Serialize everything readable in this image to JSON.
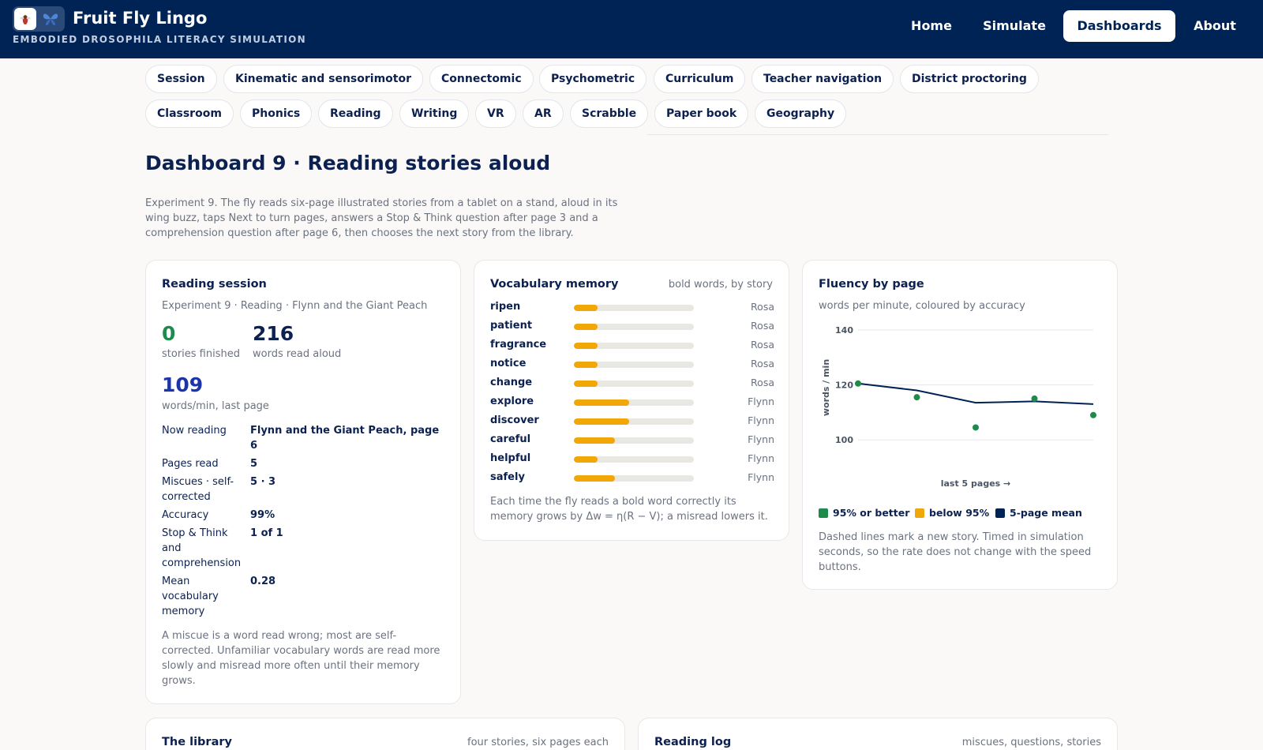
{
  "header": {
    "title": "Fruit Fly Lingo",
    "subtitle": "EMBODIED DROSOPHILA LITERACY SIMULATION",
    "nav": [
      "Home",
      "Simulate",
      "Dashboards",
      "About"
    ],
    "active_nav": "Dashboards"
  },
  "tabs": [
    [
      "Session",
      "Kinematic and sensorimotor",
      "Connectomic",
      "Psychometric",
      "Curriculum",
      "Teacher navigation",
      "District proctoring"
    ],
    [
      "Classroom",
      "Phonics",
      "Reading",
      "Writing",
      "VR",
      "AR",
      "Scrabble",
      "Paper book",
      "Geography"
    ]
  ],
  "page": {
    "title": "Dashboard 9 · Reading stories aloud",
    "intro": "Experiment 9. The fly reads six-page illustrated stories from a tablet on a stand, aloud in its wing buzz, taps Next to turn pages, answers a Stop & Think question after page 3 and a comprehension question after page 6, then chooses the next story from the library."
  },
  "session": {
    "title": "Reading session",
    "context": "Experiment 9 · Reading · Flynn and the Giant Peach",
    "stories_finished": "0",
    "stories_finished_label": "stories finished",
    "words_read": "216",
    "words_read_label": "words read aloud",
    "wpm": "109",
    "wpm_label": "words/min, last page",
    "details": [
      {
        "k": "Now reading",
        "v": "Flynn and the Giant Peach, page 6"
      },
      {
        "k": "Pages read",
        "v": "5"
      },
      {
        "k": "Miscues · self-corrected",
        "v": "5 · 3"
      },
      {
        "k": "Accuracy",
        "v": "99%"
      },
      {
        "k": "Stop & Think and comprehension",
        "v": "1 of 1"
      },
      {
        "k": "Mean vocabulary memory",
        "v": "0.28"
      }
    ],
    "note": "A miscue is a word read wrong; most are self-corrected. Unfamiliar vocabulary words are read more slowly and misread more often until their memory grows."
  },
  "vocab": {
    "title": "Vocabulary memory",
    "subtitle": "bold words, by story",
    "items": [
      {
        "word": "ripen",
        "memory": 0.2,
        "story": "Rosa"
      },
      {
        "word": "patient",
        "memory": 0.2,
        "story": "Rosa"
      },
      {
        "word": "fragrance",
        "memory": 0.2,
        "story": "Rosa"
      },
      {
        "word": "notice",
        "memory": 0.2,
        "story": "Rosa"
      },
      {
        "word": "change",
        "memory": 0.2,
        "story": "Rosa"
      },
      {
        "word": "explore",
        "memory": 0.46,
        "story": "Flynn"
      },
      {
        "word": "discover",
        "memory": 0.46,
        "story": "Flynn"
      },
      {
        "word": "careful",
        "memory": 0.34,
        "story": "Flynn"
      },
      {
        "word": "helpful",
        "memory": 0.2,
        "story": "Flynn"
      },
      {
        "word": "safely",
        "memory": 0.34,
        "story": "Flynn"
      }
    ],
    "note": "Each time the fly reads a bold word correctly its memory grows by Δw = η(R − V); a misread lowers it."
  },
  "fluency": {
    "title": "Fluency by page",
    "subtitle": "words per minute, coloured by accuracy",
    "xlabel": "last 5 pages →",
    "legend": [
      "95% or better",
      "below 95%",
      "5-page mean"
    ],
    "note": "Dashed lines mark a new story. Timed in simulation seconds, so the rate does not change with the speed buttons."
  },
  "chart_data": {
    "type": "scatter",
    "title": "Fluency by page",
    "xlabel": "last 5 pages →",
    "ylabel": "words / min",
    "ylim": [
      94,
      144
    ],
    "yticks": [
      100,
      120,
      140
    ],
    "x": [
      1,
      2,
      3,
      4,
      5
    ],
    "series": [
      {
        "name": "95% or better",
        "values": [
          120.5,
          115.5,
          104.5,
          115.0,
          109.0
        ],
        "color": "#1e8a4c"
      },
      {
        "name": "5-page mean",
        "values": [
          120.5,
          118.0,
          113.5,
          114.0,
          113.0
        ],
        "color": "#002355"
      }
    ],
    "grid": true
  },
  "bottom": {
    "library_title": "The library",
    "library_sub": "four stories, six pages each",
    "log_title": "Reading log",
    "log_sub": "miscues, questions, stories"
  },
  "colors": {
    "navy": "#002355",
    "green": "#1e8a4c",
    "amber": "#f2a708",
    "blue": "#1b34a8"
  }
}
